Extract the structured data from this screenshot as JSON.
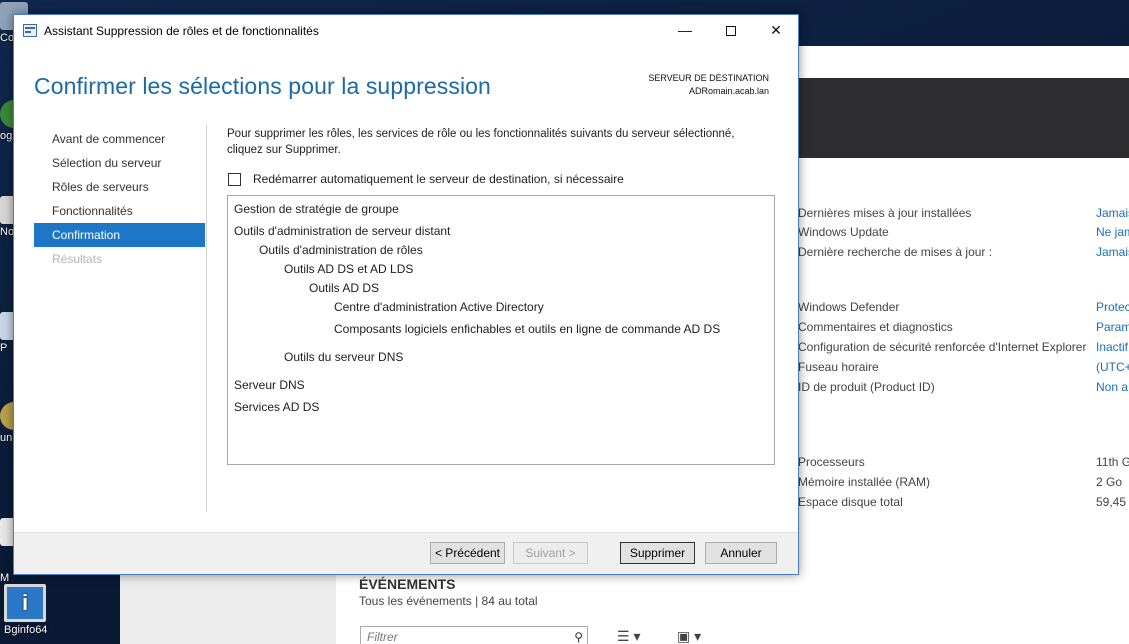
{
  "desktop": {
    "icons": [
      "Co",
      "og",
      "No",
      "P",
      "un",
      "7-\nM"
    ],
    "bginfo_label": "Bginfo64"
  },
  "server_manager": {
    "properties": [
      {
        "key": "Dernières mises à jour installées",
        "value": "Jamais"
      },
      {
        "key": "Windows Update",
        "value": "Ne jam"
      },
      {
        "key": "Dernière recherche de mises à jour :",
        "value": "Jamais"
      },
      {
        "key": "Windows Defender",
        "value": "Protec"
      },
      {
        "key": "Commentaires et diagnostics",
        "value": "Param"
      },
      {
        "key": "Configuration de sécurité renforcée d'Internet Explorer",
        "value": "Inactif"
      },
      {
        "key": "Fuseau horaire",
        "value": "(UTC+"
      },
      {
        "key": "ID de produit (Product ID)",
        "value": "Non a"
      },
      {
        "key": "Processeurs",
        "value": "11th G"
      },
      {
        "key": "Mémoire installée (RAM)",
        "value": "2 Go"
      },
      {
        "key": "Espace disque total",
        "value": "59,45"
      }
    ],
    "events_title": "ÉVÉNEMENTS",
    "events_subtitle": "Tous les événements | 84 au total",
    "filter_placeholder": "Filtrer"
  },
  "dialog": {
    "window_title": "Assistant Suppression de rôles et de fonctionnalités",
    "page_title": "Confirmer les sélections pour la suppression",
    "destination_label": "SERVEUR DE DESTINATION",
    "destination_server": "ADRomain.acab.lan",
    "nav": [
      {
        "label": "Avant de commencer",
        "state": "normal"
      },
      {
        "label": "Sélection du serveur",
        "state": "normal"
      },
      {
        "label": "Rôles de serveurs",
        "state": "normal"
      },
      {
        "label": "Fonctionnalités",
        "state": "normal"
      },
      {
        "label": "Confirmation",
        "state": "active"
      },
      {
        "label": "Résultats",
        "state": "disabled"
      }
    ],
    "intro_text": "Pour supprimer les rôles, les services de rôle ou les fonctionnalités suivants du serveur sélectionné, cliquez sur Supprimer.",
    "restart_checkbox_label": "Redémarrer automatiquement le serveur de destination, si nécessaire",
    "restart_checked": false,
    "selections": [
      {
        "label": "Gestion de stratégie de groupe",
        "level": 0
      },
      {
        "label": "Outils d'administration de serveur distant",
        "level": 0
      },
      {
        "label": "Outils d'administration de rôles",
        "level": 1
      },
      {
        "label": "Outils AD DS et AD LDS",
        "level": 2
      },
      {
        "label": "Outils AD DS",
        "level": 3
      },
      {
        "label": "Centre d'administration Active Directory",
        "level": 4
      },
      {
        "label": "Composants logiciels enfichables et outils en ligne de commande AD DS",
        "level": 4
      },
      {
        "label": "Outils du serveur DNS",
        "level": 2
      },
      {
        "label": "Serveur DNS",
        "level": 0
      },
      {
        "label": "Services AD DS",
        "level": 0
      }
    ],
    "buttons": {
      "previous": "< Précédent",
      "next": "Suivant >",
      "remove": "Supprimer",
      "cancel": "Annuler"
    }
  }
}
